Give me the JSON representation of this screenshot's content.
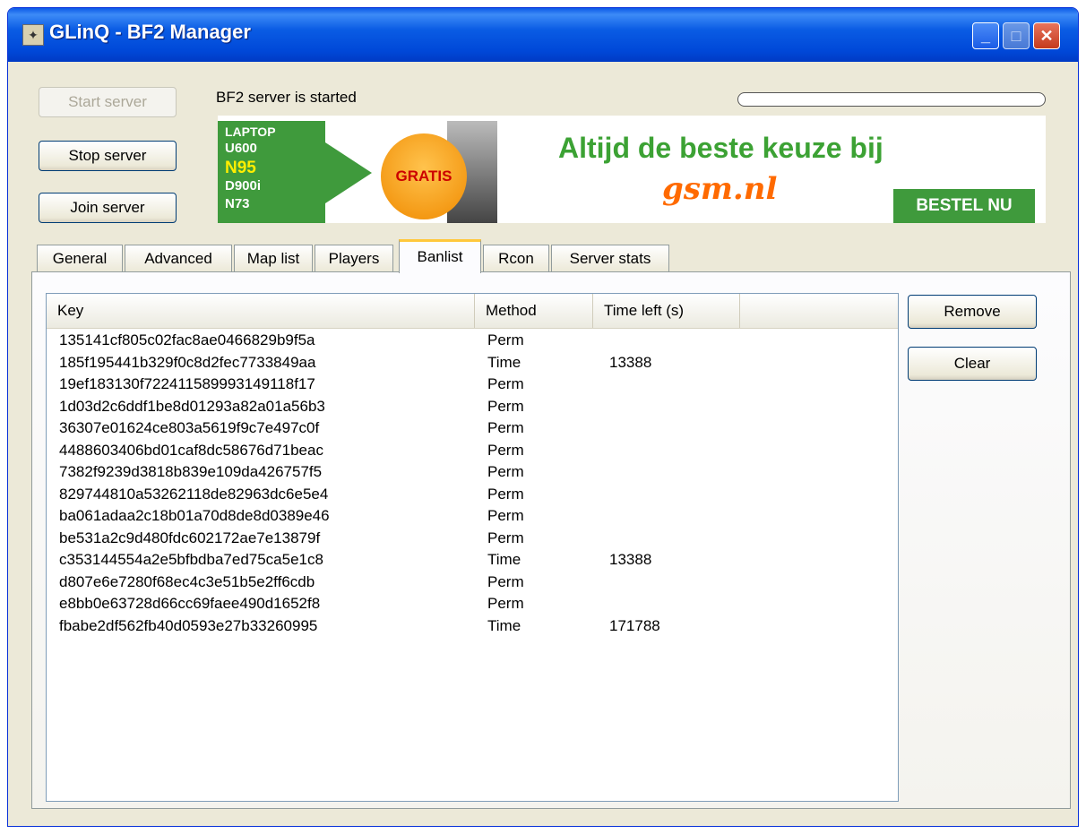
{
  "window": {
    "title": "GLinQ - BF2 Manager",
    "icon": "app-icon"
  },
  "controls": {
    "start_label": "Start server",
    "stop_label": "Stop server",
    "join_label": "Join server",
    "status_text": "BF2 server is started",
    "progress": 0
  },
  "banner": {
    "models": [
      "LAPTOP",
      "U600",
      "N95",
      "D900i",
      "N73"
    ],
    "gratis": "GRATIS",
    "headline": "Altijd de beste keuze bij",
    "logo": "gsm.nl",
    "button": "BESTEL NU",
    "brand_color": "#3f9a3c"
  },
  "tabs": [
    {
      "label": "General"
    },
    {
      "label": "Advanced"
    },
    {
      "label": "Map list"
    },
    {
      "label": "Players"
    },
    {
      "label": "Banlist"
    },
    {
      "label": "Rcon"
    },
    {
      "label": "Server stats"
    }
  ],
  "active_tab": "Banlist",
  "banlist": {
    "columns": [
      "Key",
      "Method",
      "Time left (s)"
    ],
    "rows": [
      {
        "key": "135141cf805c02fac8ae0466829b9f5a",
        "method": "Perm",
        "time": ""
      },
      {
        "key": "185f195441b329f0c8d2fec7733849aa",
        "method": "Time",
        "time": "13388"
      },
      {
        "key": "19ef183130f722411589993149118f17",
        "method": "Perm",
        "time": ""
      },
      {
        "key": "1d03d2c6ddf1be8d01293a82a01a56b3",
        "method": "Perm",
        "time": ""
      },
      {
        "key": "36307e01624ce803a5619f9c7e497c0f",
        "method": "Perm",
        "time": ""
      },
      {
        "key": "4488603406bd01caf8dc58676d71beac",
        "method": "Perm",
        "time": ""
      },
      {
        "key": "7382f9239d3818b839e109da426757f5",
        "method": "Perm",
        "time": ""
      },
      {
        "key": "829744810a53262118de82963dc6e5e4",
        "method": "Perm",
        "time": ""
      },
      {
        "key": "ba061adaa2c18b01a70d8de8d0389e46",
        "method": "Perm",
        "time": ""
      },
      {
        "key": "be531a2c9d480fdc602172ae7e13879f",
        "method": "Perm",
        "time": ""
      },
      {
        "key": "c353144554a2e5bfbdba7ed75ca5e1c8",
        "method": "Time",
        "time": "13388"
      },
      {
        "key": "d807e6e7280f68ec4c3e51b5e2ff6cdb",
        "method": "Perm",
        "time": ""
      },
      {
        "key": "e8bb0e63728d66cc69faee490d1652f8",
        "method": "Perm",
        "time": ""
      },
      {
        "key": "fbabe2df562fb40d0593e27b33260995",
        "method": "Time",
        "time": "171788"
      }
    ]
  },
  "actions": {
    "remove_label": "Remove",
    "clear_label": "Clear"
  }
}
